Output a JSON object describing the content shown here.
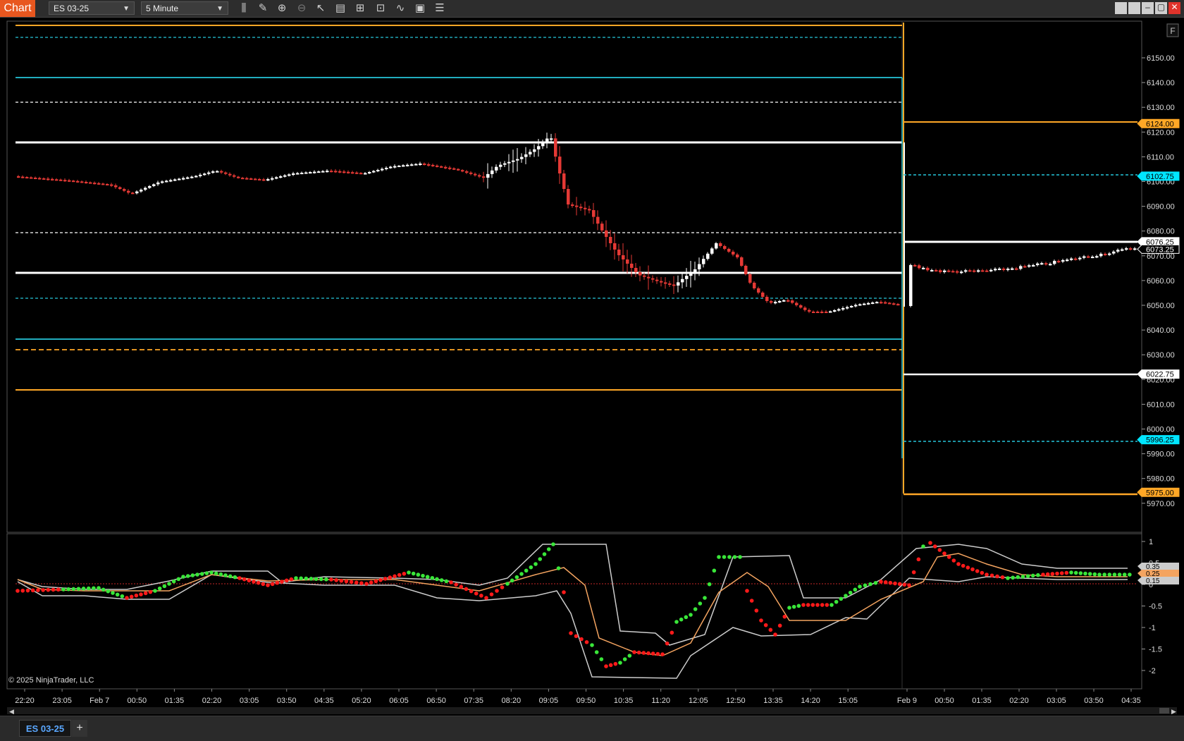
{
  "toolbar": {
    "app_label": "Chart",
    "instrument": "ES 03-25",
    "interval": "5 Minute",
    "icons": [
      "bar-type-icon",
      "pencil-draw-icon",
      "zoom-in-icon",
      "zoom-out-icon",
      "pointer-icon",
      "data-box-icon",
      "indicators-icon",
      "strategies-icon",
      "trend-icon",
      "properties-icon",
      "list-icon"
    ]
  },
  "window_controls": {
    "close": "✕",
    "maximize": "▢",
    "minimize": "–"
  },
  "chart": {
    "corner_label": "F",
    "copyright": "© 2025 NinjaTrader, LLC",
    "price_ticks": [
      "6150.00",
      "6140.00",
      "6130.00",
      "6120.00",
      "6110.00",
      "6100.00",
      "6090.00",
      "6080.00",
      "6070.00",
      "6060.00",
      "6050.00",
      "6040.00",
      "6030.00",
      "6020.00",
      "6010.00",
      "6000.00",
      "5990.00",
      "5980.00",
      "5970.00"
    ],
    "price_markers": [
      {
        "label": "6124.00",
        "color": "#ffa726"
      },
      {
        "label": "6102.75",
        "color": "#00e5ff"
      },
      {
        "label": "6076.25",
        "color": "#ffffff"
      },
      {
        "label": "6073.25",
        "color": "#000000"
      },
      {
        "label": "6022.75",
        "color": "#ffffff"
      },
      {
        "label": "5996.25",
        "color": "#00e5ff"
      },
      {
        "label": "5975.00",
        "color": "#ffa726"
      }
    ],
    "osc_ticks": [
      "1",
      "0.5",
      "0",
      "-0.5",
      "-1",
      "-1.5",
      "-2"
    ],
    "osc_markers": [
      {
        "label": "0.35"
      },
      {
        "label": "0.25"
      },
      {
        "label": "0.15"
      }
    ],
    "time_ticks": [
      "22:20",
      "23:05",
      "Feb 7",
      "00:50",
      "01:35",
      "02:20",
      "03:05",
      "03:50",
      "04:35",
      "05:20",
      "06:05",
      "06:50",
      "07:35",
      "08:20",
      "09:05",
      "09:50",
      "10:35",
      "11:20",
      "12:05",
      "12:50",
      "13:35",
      "14:20",
      "15:05",
      "Feb 9",
      "00:50",
      "01:35",
      "02:20",
      "03:05",
      "03:50",
      "04:35"
    ],
    "colors": {
      "up": "#ffffff",
      "down": "#e53935",
      "orange": "#ffa726",
      "cyan": "#26c6da",
      "green": "#39e639",
      "red": "#ff1a1a"
    }
  },
  "tabs": {
    "active": "ES 03-25",
    "add": "+"
  }
}
